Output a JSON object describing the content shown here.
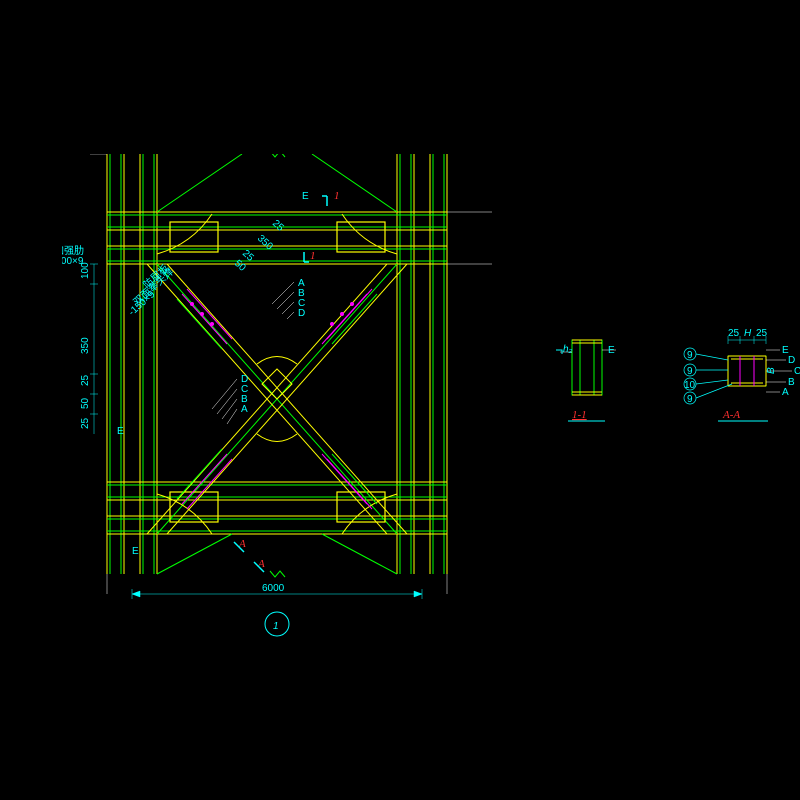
{
  "main_view": {
    "span": "6000",
    "view_num": "1",
    "section_marks": [
      "E",
      "1",
      "1",
      "E",
      "A",
      "B",
      "C",
      "D",
      "A",
      "B",
      "C",
      "D",
      "A",
      "A"
    ],
    "annotations": {
      "jingjia": "加强肋",
      "jingjia_spec": "-100×9",
      "quzhepan": "防屈板",
      "shuangmian": "双面奉头焊",
      "shuangmian_spec": "-150×9"
    },
    "dims_left": [
      "100",
      "350",
      "25",
      "50",
      "25"
    ],
    "dims_top": [
      "25",
      "350",
      "25",
      "50"
    ]
  },
  "section_11": {
    "title": "1-1",
    "label": "E",
    "hx": "h₂"
  },
  "section_AA": {
    "title": "A-A",
    "bubbles": [
      "9",
      "9",
      "10",
      "9"
    ],
    "letters": [
      "A",
      "B",
      "C",
      "D",
      "E"
    ],
    "dims": [
      "25",
      "H",
      "25",
      "B"
    ]
  }
}
